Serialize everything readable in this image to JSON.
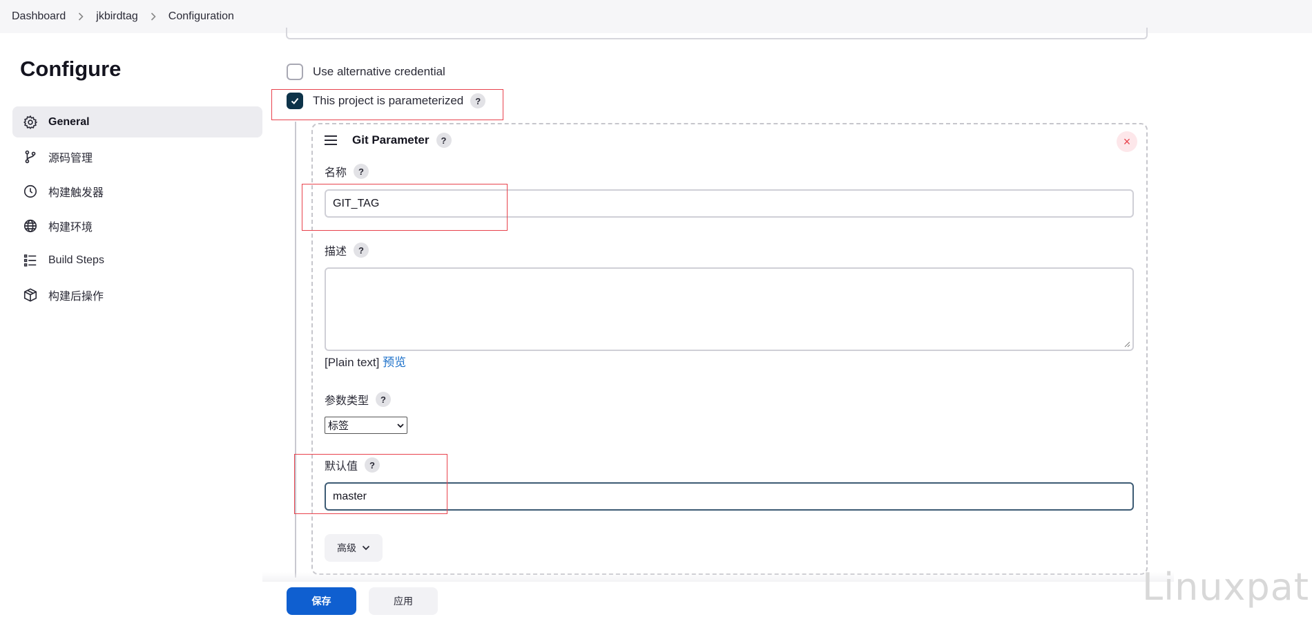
{
  "breadcrumb": {
    "items": [
      "Dashboard",
      "jkbirdtag",
      "Configuration"
    ]
  },
  "page": {
    "title": "Configure"
  },
  "sidebar": {
    "items": [
      {
        "label": "General",
        "icon": "gear-icon",
        "active": true
      },
      {
        "label": "源码管理",
        "icon": "branch-icon"
      },
      {
        "label": "构建触发器",
        "icon": "clock-icon"
      },
      {
        "label": "构建环境",
        "icon": "globe-icon"
      },
      {
        "label": "Build Steps",
        "icon": "list-icon"
      },
      {
        "label": "构建后操作",
        "icon": "package-icon"
      }
    ]
  },
  "form": {
    "alt_credential_label": "Use alternative credential",
    "alt_credential_checked": false,
    "parameterized_label": "This project is parameterized",
    "parameterized_checked": true,
    "help_glyph": "?",
    "git_parameter": {
      "title": "Git Parameter",
      "close_glyph": "×",
      "name_label": "名称",
      "name_value": "GIT_TAG",
      "description_label": "描述",
      "description_value": "",
      "plain_text": "[Plain text]",
      "preview_link": "预览",
      "type_label": "参数类型",
      "type_value": "标签",
      "default_label": "默认值",
      "default_value": "master",
      "advanced_label": "高级"
    }
  },
  "actions": {
    "save": "保存",
    "apply": "应用"
  },
  "watermark": "Linuxpath",
  "colors": {
    "primary": "#0f5fd0",
    "checkbox_checked": "#0d3349",
    "annotation": "#e8414b",
    "link": "#1a6fc9"
  }
}
